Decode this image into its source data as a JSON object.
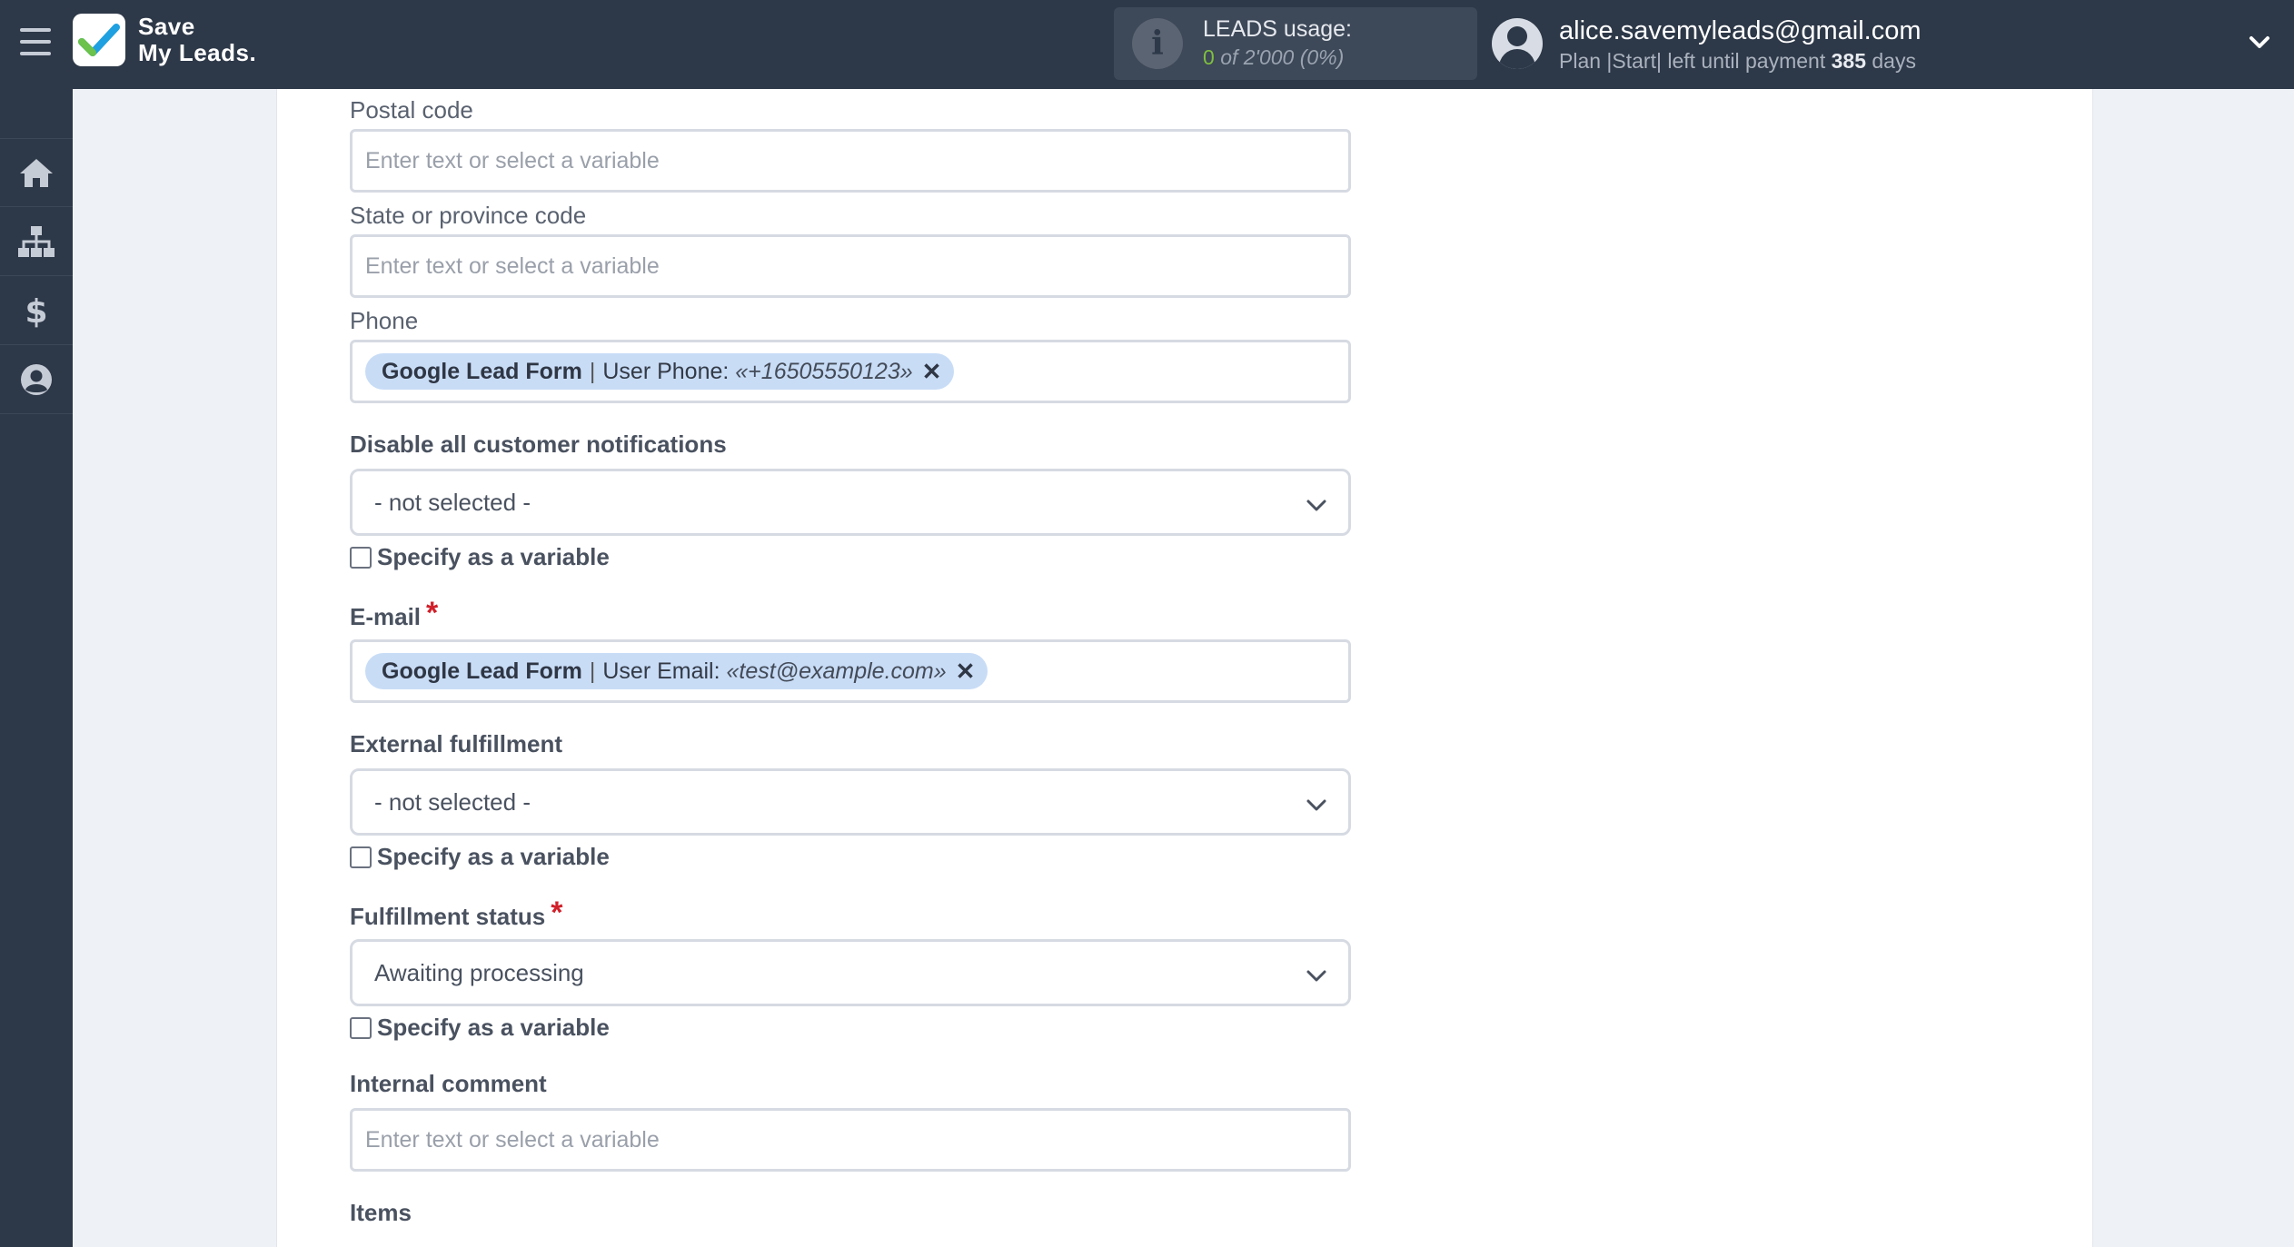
{
  "brand": {
    "line1": "Save",
    "line2": "My Leads."
  },
  "leads_usage": {
    "title": "LEADS usage:",
    "used": "0",
    "of_total": "of 2'000",
    "percent": "(0%)"
  },
  "user": {
    "email": "alice.savemyleads@gmail.com",
    "plan_prefix": "Plan |Start| left until payment",
    "days_left": "385",
    "days_suffix": "days"
  },
  "sidebar": {
    "items": [
      {
        "icon": "home-icon"
      },
      {
        "icon": "sitemap-icon"
      },
      {
        "icon": "dollar-icon"
      },
      {
        "icon": "user-circle-icon"
      }
    ]
  },
  "form": {
    "postal_code": {
      "label": "Postal code",
      "placeholder": "Enter text or select a variable"
    },
    "state_code": {
      "label": "State or province code",
      "placeholder": "Enter text or select a variable"
    },
    "phone": {
      "label": "Phone",
      "tag_source": "Google Lead Form",
      "tag_separator": "|",
      "tag_field": "User Phone:",
      "tag_value": "«+16505550123»"
    },
    "disable_notifications": {
      "label": "Disable all customer notifications",
      "value": "- not selected -",
      "checkbox": "Specify as a variable"
    },
    "email": {
      "label": "E-mail",
      "required_mark": "*",
      "tag_source": "Google Lead Form",
      "tag_separator": "|",
      "tag_field": "User Email:",
      "tag_value": "«test@example.com»"
    },
    "external_fulfillment": {
      "label": "External fulfillment",
      "value": "- not selected -",
      "checkbox": "Specify as a variable"
    },
    "fulfillment_status": {
      "label": "Fulfillment status",
      "required_mark": "*",
      "value": "Awaiting processing",
      "checkbox": "Specify as a variable"
    },
    "internal_comment": {
      "label": "Internal comment",
      "placeholder": "Enter text or select a variable"
    },
    "items": {
      "label": "Items"
    }
  },
  "colors": {
    "header_bg": "#2d3848",
    "tag_bg": "#c8dcf6",
    "usage_green": "#7fbf40",
    "required_red": "#d0202a"
  }
}
